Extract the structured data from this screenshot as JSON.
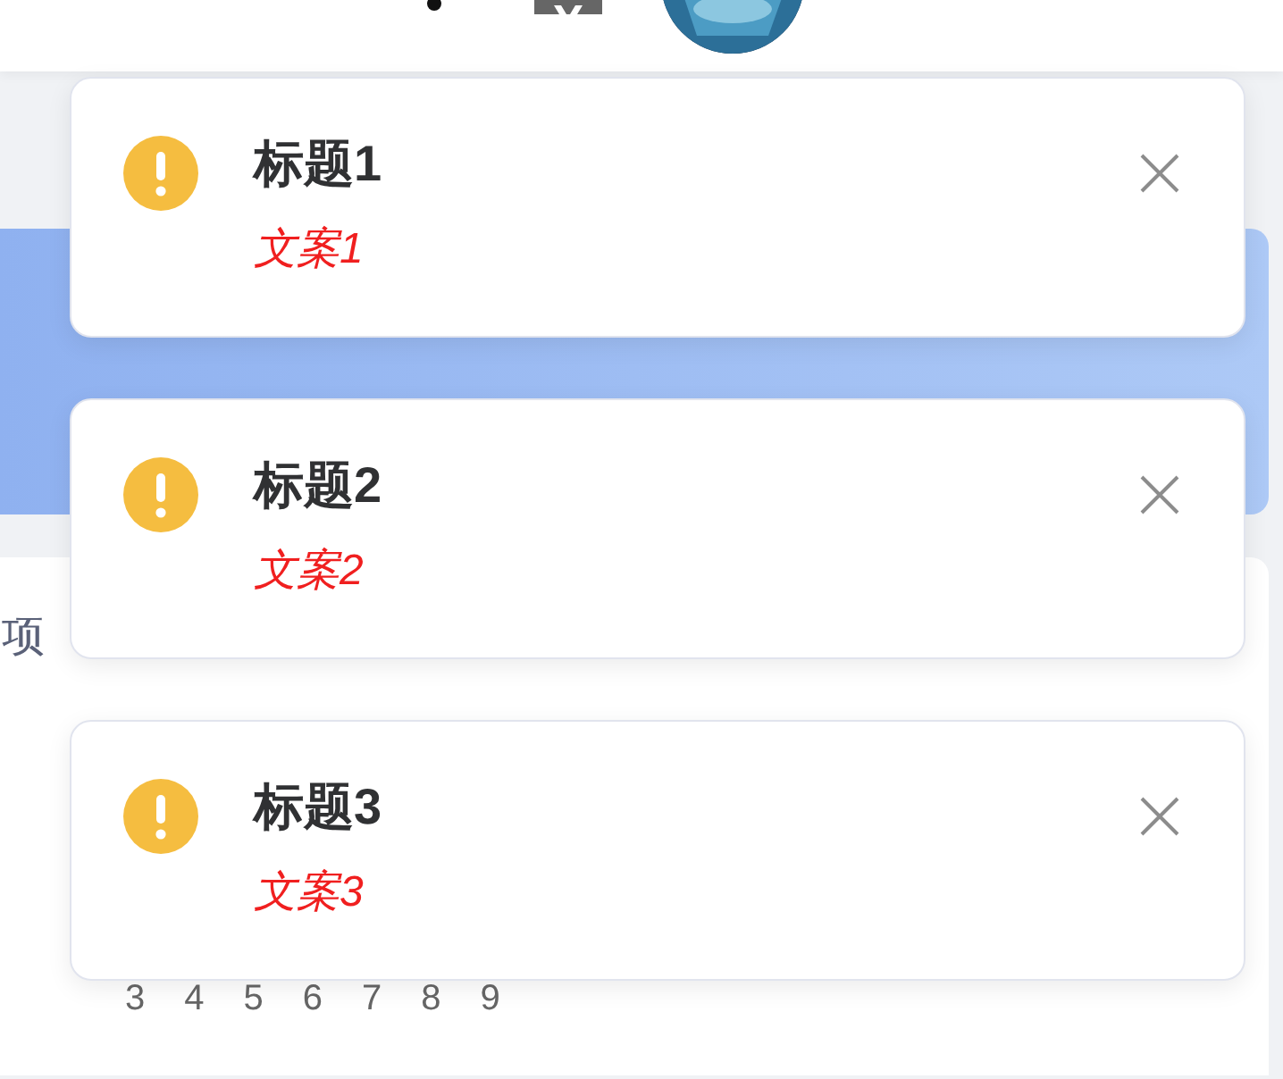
{
  "panel": {
    "label": "项",
    "pages": [
      "3",
      "4",
      "5",
      "6",
      "7",
      "8",
      "9"
    ]
  },
  "notifications": [
    {
      "kind": "warning",
      "title": "标题1",
      "message": "文案1"
    },
    {
      "kind": "warning",
      "title": "标题2",
      "message": "文案2"
    },
    {
      "kind": "warning",
      "title": "标题3",
      "message": "文案3"
    }
  ]
}
